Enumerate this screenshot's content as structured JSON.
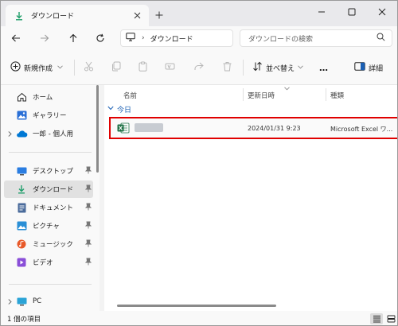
{
  "tab": {
    "title": "ダウンロード"
  },
  "address": {
    "path": "ダウンロード",
    "separator": "›"
  },
  "search": {
    "placeholder": "ダウンロードの検索"
  },
  "commands": {
    "new_label": "新規作成",
    "sort_label": "並べ替え",
    "more_label": "…",
    "details_label": "詳細"
  },
  "sidebar": {
    "items": [
      {
        "label": "ホーム"
      },
      {
        "label": "ギャラリー"
      },
      {
        "label": "一郎 - 個人用"
      },
      {
        "label": "デスクトップ"
      },
      {
        "label": "ダウンロード"
      },
      {
        "label": "ドキュメント"
      },
      {
        "label": "ピクチャ"
      },
      {
        "label": "ミュージック"
      },
      {
        "label": "ビデオ"
      },
      {
        "label": "PC"
      }
    ]
  },
  "columns": {
    "name": "名前",
    "modified": "更新日時",
    "type": "種類"
  },
  "group": {
    "label": "今日"
  },
  "file": {
    "date": "2024/01/31 9:23",
    "type": "Microsoft Excel ワ..."
  },
  "status": {
    "count_text": "1 個の項目"
  },
  "colors": {
    "accent": "#1a5fb4",
    "highlight_border": "#e00000",
    "excel_green": "#1e7145",
    "onedrive_blue": "#0078d4"
  }
}
